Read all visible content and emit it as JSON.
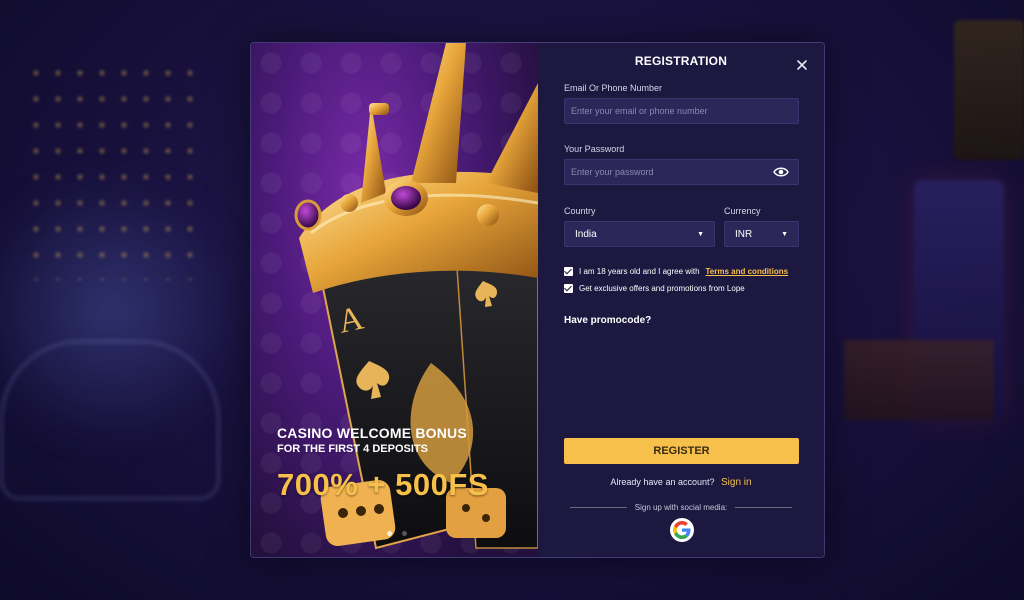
{
  "colors": {
    "accent": "#f7c04a",
    "form_bg": "#1c1840",
    "input_bg": "#2b2758",
    "page_bg": "#1a1240"
  },
  "promo": {
    "title": "CASINO WELCOME BONUS",
    "subtitle": "FOR THE FIRST 4 DEPOSITS",
    "amount": "700% + 500FS",
    "slides_total": 2,
    "active_slide": 1
  },
  "form": {
    "title": "REGISTRATION",
    "close_icon": "close-icon",
    "email": {
      "label": "Email Or Phone Number",
      "placeholder": "Enter your email or phone number",
      "value": ""
    },
    "password": {
      "label": "Your Password",
      "placeholder": "Enter your password",
      "value": "",
      "toggle_icon": "eye-icon"
    },
    "country": {
      "label": "Country",
      "value": "India"
    },
    "currency": {
      "label": "Currency",
      "value": "INR"
    },
    "age_check": {
      "checked": true,
      "text": "I am 18 years old and I agree with",
      "link": "Terms and conditions"
    },
    "offers_check": {
      "checked": true,
      "text": "Get exclusive offers and promotions from Lope"
    },
    "promocode_label": "Have promocode?",
    "register_label": "REGISTER",
    "account_text": "Already have an account?",
    "signin_label": "Sign in",
    "social_text": "Sign up with social media:",
    "social_icon": "google-icon"
  }
}
